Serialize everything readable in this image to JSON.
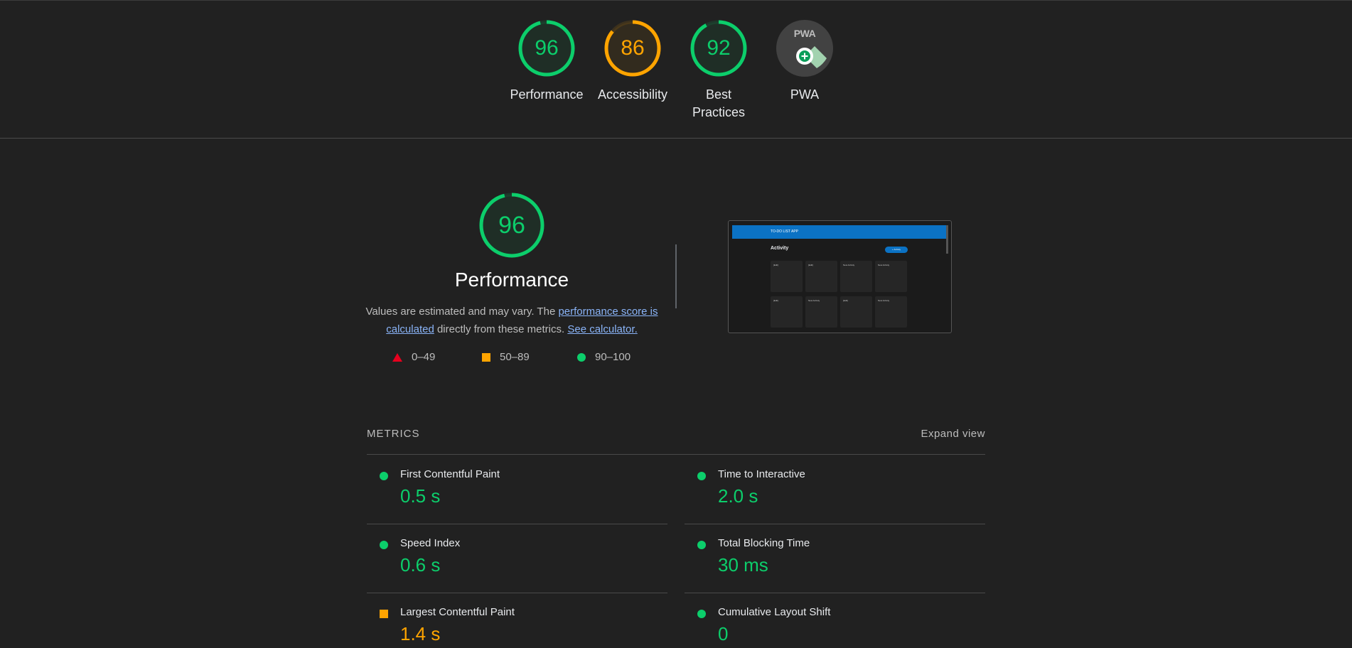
{
  "colors": {
    "pass": "#0cce6b",
    "average": "#ffa400",
    "fail": "#e6001e",
    "background": "#212121"
  },
  "category_gauges": [
    {
      "label": "Performance",
      "score": "96",
      "status": "pass"
    },
    {
      "label": "Accessibility",
      "score": "86",
      "status": "average"
    },
    {
      "label": "Best Practices",
      "score": "92",
      "status": "pass"
    },
    {
      "label": "PWA",
      "score": "",
      "status": "pwa",
      "badge_text": "PWA"
    }
  ],
  "performance": {
    "score": "96",
    "title": "Performance",
    "desc_before": "Values are estimated and may vary. The ",
    "desc_link": "performance score is calculated",
    "desc_middle": " directly from these metrics. ",
    "calculator_link": "See calculator."
  },
  "legend": [
    {
      "range": "0–49",
      "icon": "triangle-icon"
    },
    {
      "range": "50–89",
      "icon": "square-icon"
    },
    {
      "range": "90–100",
      "icon": "circle-icon"
    }
  ],
  "screenshot": {
    "app_title": "TO-DO LIST APP",
    "heading": "Activity",
    "button": "+ Activity",
    "cards": [
      "[Edit]",
      "[Edit]",
      "New Activity",
      "New Activity",
      "[Edit]",
      "New Activity",
      "[Edit]",
      "New Activity"
    ]
  },
  "metrics": {
    "title": "METRICS",
    "expand_label": "Expand view",
    "items": [
      {
        "label": "First Contentful Paint",
        "value": "0.5 s",
        "status": "pass"
      },
      {
        "label": "Time to Interactive",
        "value": "2.0 s",
        "status": "pass"
      },
      {
        "label": "Speed Index",
        "value": "0.6 s",
        "status": "pass"
      },
      {
        "label": "Total Blocking Time",
        "value": "30 ms",
        "status": "pass"
      },
      {
        "label": "Largest Contentful Paint",
        "value": "1.4 s",
        "status": "average"
      },
      {
        "label": "Cumulative Layout Shift",
        "value": "0",
        "status": "pass"
      }
    ]
  }
}
